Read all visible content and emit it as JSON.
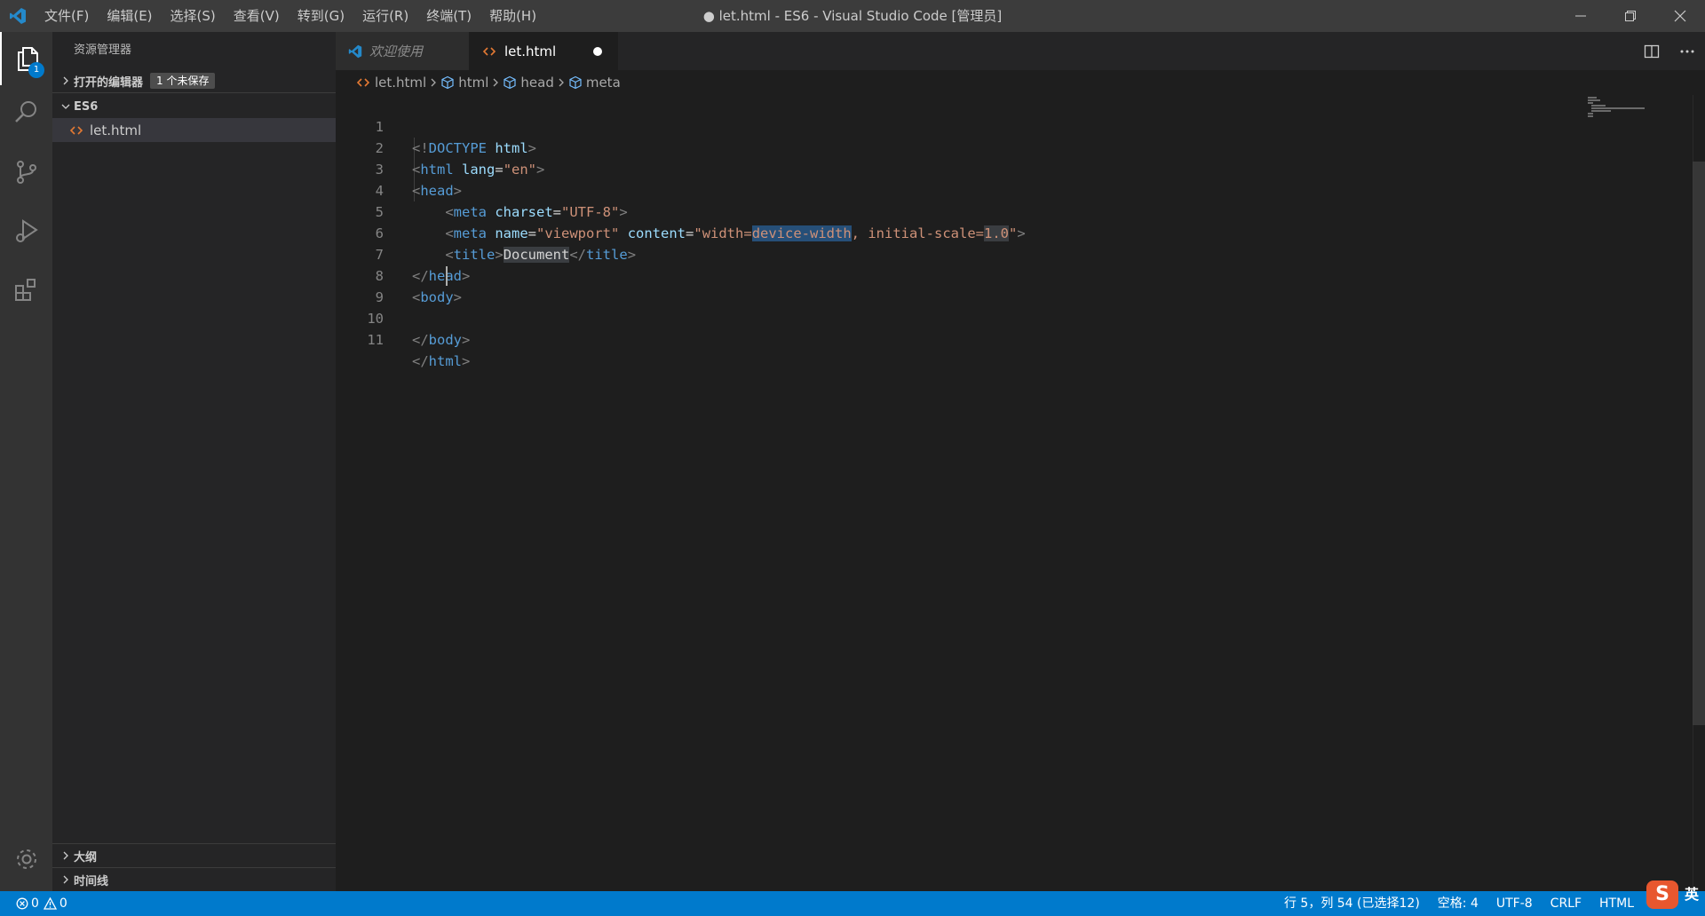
{
  "titlebar": {
    "menu": [
      "文件(F)",
      "编辑(E)",
      "选择(S)",
      "查看(V)",
      "转到(G)",
      "运行(R)",
      "终端(T)",
      "帮助(H)"
    ],
    "window_title": "● let.html - ES6 - Visual Studio Code [管理员]"
  },
  "activity": {
    "explorer_badge": "1"
  },
  "sidebar": {
    "title": "资源管理器",
    "open_editors_label": "打开的编辑器",
    "open_editors_badge": "1 个未保存",
    "folder_label": "ES6",
    "files": [
      "let.html"
    ],
    "outline_label": "大纲",
    "timeline_label": "时间线"
  },
  "tabs": {
    "welcome": "欢迎使用",
    "active": "let.html"
  },
  "breadcrumb": [
    "let.html",
    "html",
    "head",
    "meta"
  ],
  "editor": {
    "line_numbers": [
      "1",
      "2",
      "3",
      "4",
      "5",
      "6",
      "7",
      "8",
      "9",
      "10",
      "11"
    ],
    "code": {
      "l1_punc_open": "<!",
      "l1_doctype": "DOCTYPE",
      "l1_html": "html",
      "l1_punc_close": ">",
      "l2_tag": "html",
      "l2_attr": "lang",
      "l2_val": "\"en\"",
      "l3_tag": "head",
      "l4_tag": "meta",
      "l4_attr": "charset",
      "l4_val": "\"UTF-8\"",
      "l5_tag": "meta",
      "l5_attr1": "name",
      "l5_val1": "\"viewport\"",
      "l5_attr2": "content",
      "l5_val2_a": "\"width=",
      "l5_val2_sel": "device-width",
      "l5_val2_b": ", initial-scale=",
      "l5_val2_hl": "1.0",
      "l5_val2_c": "\"",
      "l6_tag": "title",
      "l6_text": "Document",
      "l7_tag": "head",
      "l8_tag": "body",
      "l10_tag": "body",
      "l11_tag": "html"
    }
  },
  "statusbar": {
    "errors": "0",
    "warnings": "0",
    "position": "行 5，列 54 (已选择12)",
    "spaces": "空格: 4",
    "encoding": "UTF-8",
    "eol": "CRLF",
    "language": "HTML",
    "ime_lang": "英",
    "ime_logo": "S"
  },
  "colors": {
    "accent": "#007acc",
    "titlebar": "#3c3c3c",
    "sidebar": "#252526",
    "editor": "#1e1e1e"
  }
}
